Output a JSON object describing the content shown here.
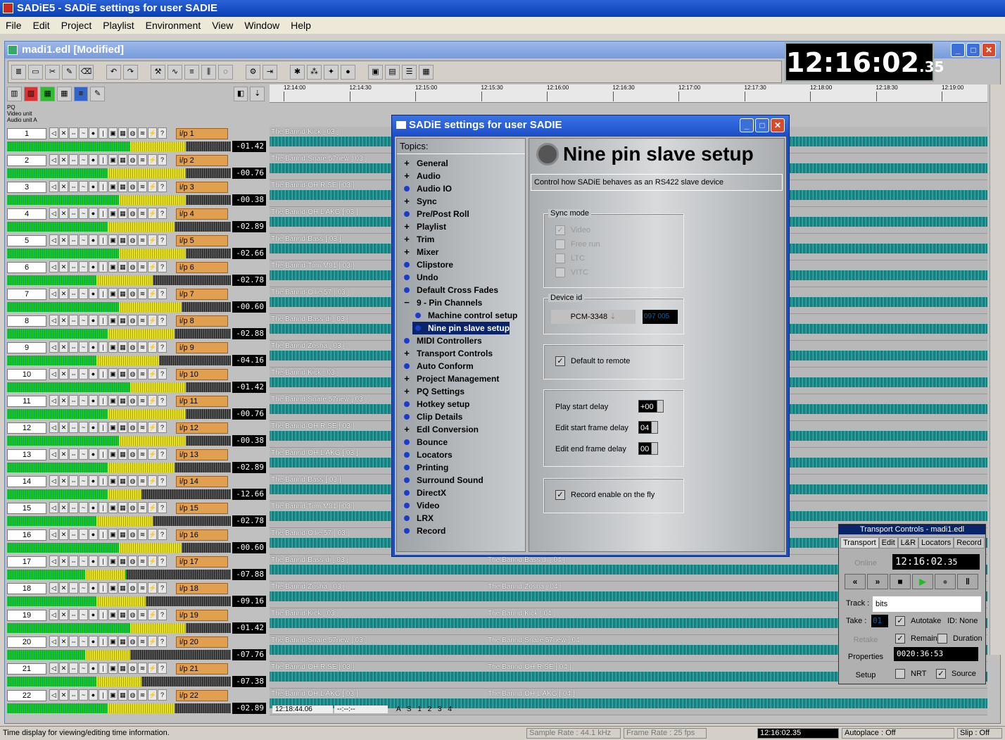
{
  "app": {
    "title": "SADiE5 - SADiE settings for user SADIE"
  },
  "menu": [
    "File",
    "Edit",
    "Project",
    "Playlist",
    "Environment",
    "View",
    "Window",
    "Help"
  ],
  "project": {
    "title": "madi1.edl [Modified]"
  },
  "clock": {
    "main": "12:16:02",
    "frames": ".35"
  },
  "track_header": {
    "line1": "PQ",
    "line2": "Video unit",
    "line3": "Audio unit A"
  },
  "tracks": [
    {
      "num": "1",
      "input": "i/p 1",
      "level": "-01.42",
      "clip": "The Bannd-Kick [ 03 ]"
    },
    {
      "num": "2",
      "input": "i/p 2",
      "level": "-00.76",
      "clip": "The Bannd-Snare 57new [ 03 ]"
    },
    {
      "num": "3",
      "input": "i/p 3",
      "level": "-00.38",
      "clip": "The Bannd-OH R SE [ 03 ]"
    },
    {
      "num": "4",
      "input": "i/p 4",
      "level": "-02.89",
      "clip": "The Bannd-OH L AKG [ 03 ]"
    },
    {
      "num": "5",
      "input": "i/p 5",
      "level": "-02.66",
      "clip": "The Bannd-Bass [ 03 ]"
    },
    {
      "num": "6",
      "input": "i/p 6",
      "level": "-02.78",
      "clip": "The Bannd-Tom M81 [ 03 ]"
    },
    {
      "num": "7",
      "input": "i/p 7",
      "level": "-00.60",
      "clip": "The Bannd-Ollie 57 [ 03 ]"
    },
    {
      "num": "8",
      "input": "i/p 8",
      "level": "-02.88",
      "clip": "The Bannd-Bass di [ 03 ]"
    },
    {
      "num": "9",
      "input": "i/p 9",
      "level": "-04.16",
      "clip": "The Bannd-Zosha [ 03 ]"
    },
    {
      "num": "10",
      "input": "i/p 10",
      "level": "-01.42",
      "clip": "The Bannd-Kick [ 03 ]"
    },
    {
      "num": "11",
      "input": "i/p 11",
      "level": "-00.76",
      "clip": "The Bannd-Snare 57new [ 03 ]"
    },
    {
      "num": "12",
      "input": "i/p 12",
      "level": "-00.38",
      "clip": "The Bannd-OH R SE [ 03 ]"
    },
    {
      "num": "13",
      "input": "i/p 13",
      "level": "-02.89",
      "clip": "The Bannd-OH L AKG [ 03 ]"
    },
    {
      "num": "14",
      "input": "i/p 14",
      "level": "-12.66",
      "clip": "The Bannd-Bass [ 03 ]"
    },
    {
      "num": "15",
      "input": "i/p 15",
      "level": "-02.78",
      "clip": "The Bannd-Tom M81 [ 03 ]"
    },
    {
      "num": "16",
      "input": "i/p 16",
      "level": "-00.60",
      "clip": "The Bannd-Ollie 57 [ 03 ]"
    },
    {
      "num": "17",
      "input": "i/p 17",
      "level": "-07.88",
      "clip": "The Bannd-Bass di [ 03 ]",
      "clip2": "The Bannd-Bass di [ 04 ]"
    },
    {
      "num": "18",
      "input": "i/p 18",
      "level": "-09.16",
      "clip": "The Bannd-Zosha [ 03 ]",
      "clip2": "The Bannd-Zosha [ 04 ]"
    },
    {
      "num": "19",
      "input": "i/p 19",
      "level": "-01.42",
      "clip": "The Bannd-Kick [ 03 ]",
      "clip2": "The Bannd-Kick [ 04 ]"
    },
    {
      "num": "20",
      "input": "i/p 20",
      "level": "-07.76",
      "clip": "The Bannd-Snare 57new [ 03 ]",
      "clip2": "The Bannd-Snare 57new [ 04 ]"
    },
    {
      "num": "21",
      "input": "i/p 21",
      "level": "-07.38",
      "clip": "The Bannd-OH R SE [ 03 ]",
      "clip2": "The Bannd-OH R SE [ 04 ]"
    },
    {
      "num": "22",
      "input": "i/p 22",
      "level": "-02.89",
      "clip": "The Bannd-OH L AKG [ 03 ]",
      "clip2": "The Bannd-OH L AKG [ 04 ]"
    }
  ],
  "timeline": [
    "12:14:00",
    "12:14:30",
    "12:15:00",
    "12:15:30",
    "12:16:00",
    "12:16:30",
    "12:17:00",
    "12:17:30",
    "12:18:00",
    "12:18:30",
    "12:19:00"
  ],
  "bottom": {
    "time": "12:18:44.06",
    "blank": "--:--:--",
    "marks": "A S 1 2 3 4"
  },
  "dialog": {
    "title": "SADiE settings for user SADIE",
    "topics_header": "Topics:",
    "topics": [
      {
        "label": "General",
        "kind": "plus"
      },
      {
        "label": "Audio",
        "kind": "plus"
      },
      {
        "label": "Audio IO",
        "kind": "dot"
      },
      {
        "label": "Sync",
        "kind": "plus"
      },
      {
        "label": "Pre/Post Roll",
        "kind": "dot"
      },
      {
        "label": "Playlist",
        "kind": "plus"
      },
      {
        "label": "Trim",
        "kind": "plus"
      },
      {
        "label": "Mixer",
        "kind": "plus"
      },
      {
        "label": "Clipstore",
        "kind": "dot"
      },
      {
        "label": "Undo",
        "kind": "dot"
      },
      {
        "label": "Default Cross Fades",
        "kind": "dot"
      },
      {
        "label": "9 - Pin Channels",
        "kind": "minus"
      },
      {
        "label": "Machine control setup",
        "kind": "dot",
        "indent": true
      },
      {
        "label": "Nine pin slave setup",
        "kind": "dot",
        "indent": true,
        "selected": true
      },
      {
        "label": "MIDI Controllers",
        "kind": "dot"
      },
      {
        "label": "Transport Controls",
        "kind": "plus"
      },
      {
        "label": "Auto Conform",
        "kind": "dot"
      },
      {
        "label": "Project Management",
        "kind": "plus"
      },
      {
        "label": "PQ Settings",
        "kind": "plus"
      },
      {
        "label": "Hotkey setup",
        "kind": "dot"
      },
      {
        "label": "Clip Details",
        "kind": "dot"
      },
      {
        "label": "Edl Conversion",
        "kind": "plus"
      },
      {
        "label": "Bounce",
        "kind": "dot"
      },
      {
        "label": "Locators",
        "kind": "dot"
      },
      {
        "label": "Printing",
        "kind": "dot"
      },
      {
        "label": "Surround Sound",
        "kind": "dot"
      },
      {
        "label": "DirectX",
        "kind": "dot"
      },
      {
        "label": "Video",
        "kind": "dot"
      },
      {
        "label": "LRX",
        "kind": "dot"
      },
      {
        "label": "Record",
        "kind": "dot"
      }
    ],
    "panel": {
      "title": "Nine pin slave setup",
      "description": "Control how SADiE behaves as an RS422 slave device",
      "sync_mode": {
        "label": "Sync mode",
        "options": [
          "Video",
          "Free run",
          "LTC",
          "VITC"
        ]
      },
      "device_id": {
        "label": "Device id",
        "value": "PCM-3348",
        "code1": "097",
        "code2": "005"
      },
      "default_remote": "Default to remote",
      "play_start_delay": {
        "label": "Play start delay",
        "value": "+00"
      },
      "edit_start_delay": {
        "label": "Edit start frame delay",
        "value": "04"
      },
      "edit_end_delay": {
        "label": "Edit end frame delay",
        "value": "00"
      },
      "record_fly": "Record enable on the fly"
    }
  },
  "transport": {
    "title": "Transport Controls - madi1.edl",
    "tabs": [
      "Transport",
      "Edit",
      "L&R",
      "Locators",
      "Record"
    ],
    "online": "Online",
    "time": "12:16:02",
    "frames": ".35",
    "buttons": [
      "«",
      "»",
      "■",
      "▶",
      "●",
      "‖"
    ],
    "track_label": "Track :",
    "track_value": "bits",
    "take_label": "Take :",
    "take_value": "01",
    "autotake": "Autotake",
    "id_label": "ID: None",
    "retake": "Retake",
    "remain": "Remain",
    "duration": "Duration",
    "properties": "Properties",
    "remain_time": "0020:36:53",
    "setup": "Setup",
    "nrt": "NRT",
    "source": "Source"
  },
  "status": {
    "help": "Time display for viewing/editing time information.",
    "sample_rate": "Sample Rate :  44.1 kHz",
    "frame_rate": "Frame Rate :  25 fps",
    "time": "12:16:02.35",
    "autoplace": "Autoplace :  Off",
    "slip": "Slip :  Off"
  }
}
